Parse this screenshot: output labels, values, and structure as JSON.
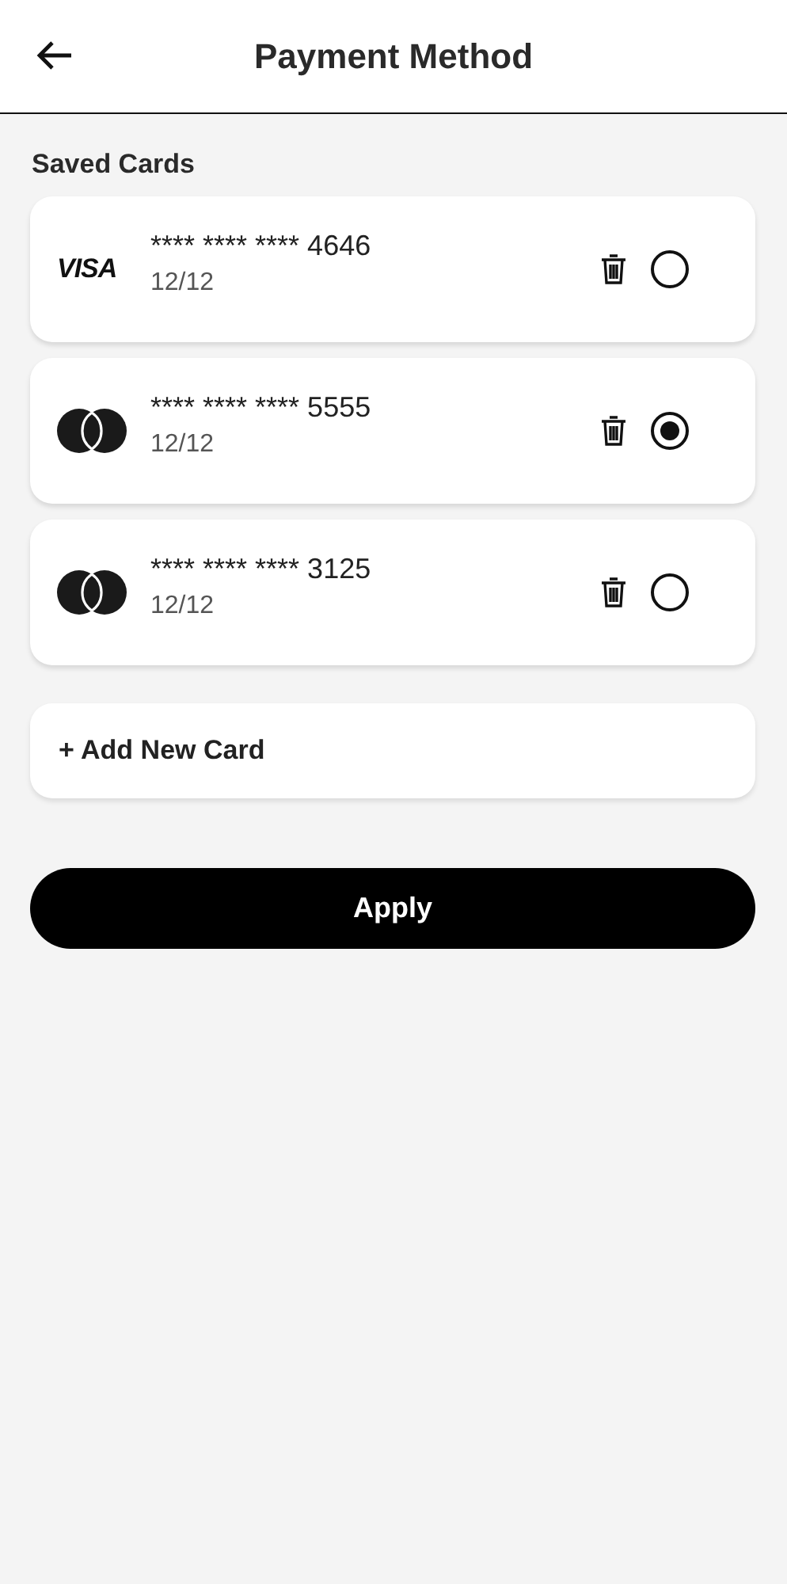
{
  "header": {
    "title": "Payment Method"
  },
  "section_title": "Saved Cards",
  "cards": [
    {
      "kind": "visa",
      "brand": "VISA",
      "number": "**** **** **** 4646",
      "expiry": "12/12",
      "selected": false
    },
    {
      "kind": "mastercard",
      "number": "**** **** **** 5555",
      "expiry": "12/12",
      "selected": true
    },
    {
      "kind": "mastercard",
      "number": "**** **** **** 3125",
      "expiry": "12/12",
      "selected": false
    }
  ],
  "add_card": "+ Add New Card",
  "apply_button": "Apply"
}
